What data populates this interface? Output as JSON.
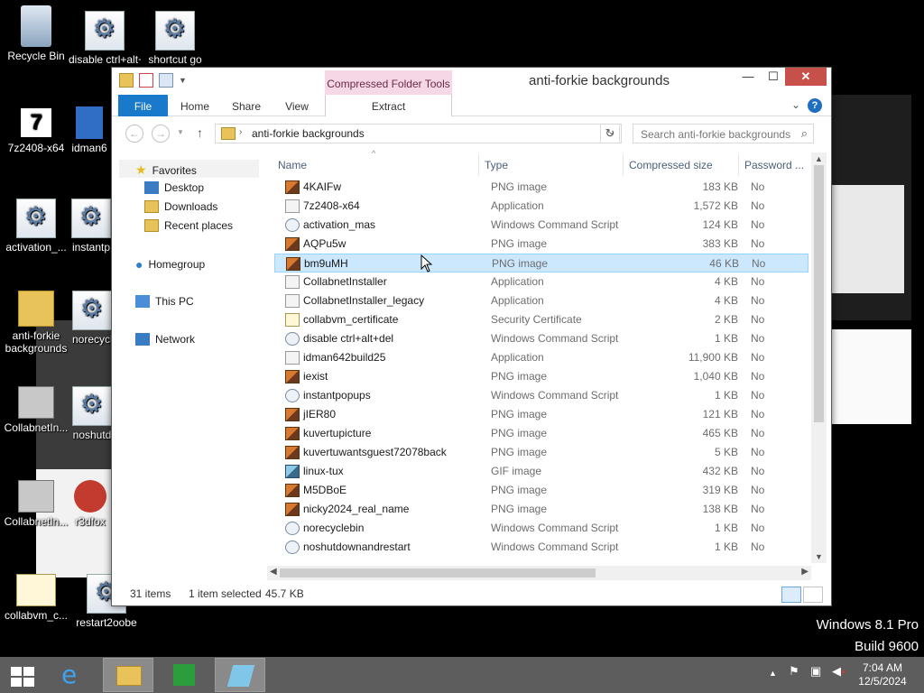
{
  "desktop": {
    "icons": [
      {
        "label": "Recycle Bin"
      },
      {
        "label": "disable ctrl+alt+"
      },
      {
        "label": "shortcut go"
      },
      {
        "label": "7z2408-x64"
      },
      {
        "label": "idman6"
      },
      {
        "label": "activation_..."
      },
      {
        "label": "instantp"
      },
      {
        "label": "anti-forkie backgrounds"
      },
      {
        "label": "norecycl"
      },
      {
        "label": "CollabnetIn..."
      },
      {
        "label": "noshutd"
      },
      {
        "label": "CollabnetIn..."
      },
      {
        "label": "r3dfox"
      },
      {
        "label": "collabvm_c..."
      },
      {
        "label": "restart2oobe"
      }
    ],
    "watermark": {
      "line1": "Windows 8.1 Pro",
      "line2": "Build 9600"
    }
  },
  "window": {
    "title": "anti-forkie backgrounds",
    "context_group": "Compressed Folder Tools",
    "controls": {
      "minimize": "—",
      "maximize": "☐",
      "close": "✕"
    },
    "ribbon_tabs": {
      "file": "File",
      "home": "Home",
      "share": "Share",
      "view": "View",
      "extract": "Extract"
    },
    "address": {
      "path": "anti-forkie backgrounds"
    },
    "search": {
      "placeholder": "Search anti-forkie backgrounds"
    },
    "nav_pane": {
      "favorites": "Favorites",
      "desktop": "Desktop",
      "downloads": "Downloads",
      "recent": "Recent places",
      "homegroup": "Homegroup",
      "thispc": "This PC",
      "network": "Network"
    },
    "columns": {
      "name": "Name",
      "type": "Type",
      "size": "Compressed size",
      "password": "Password ..."
    },
    "files": [
      {
        "name": "4KAIFw",
        "type": "PNG image",
        "size": "183 KB",
        "pw": "No",
        "icon": "png"
      },
      {
        "name": "7z2408-x64",
        "type": "Application",
        "size": "1,572 KB",
        "pw": "No",
        "icon": "app"
      },
      {
        "name": "activation_mas",
        "type": "Windows Command Script",
        "size": "124 KB",
        "pw": "No",
        "icon": "script"
      },
      {
        "name": "AQPu5w",
        "type": "PNG image",
        "size": "383 KB",
        "pw": "No",
        "icon": "png"
      },
      {
        "name": "bm9uMH",
        "type": "PNG image",
        "size": "46 KB",
        "pw": "No",
        "icon": "png",
        "selected": true
      },
      {
        "name": "CollabnetInstaller",
        "type": "Application",
        "size": "4 KB",
        "pw": "No",
        "icon": "app"
      },
      {
        "name": "CollabnetInstaller_legacy",
        "type": "Application",
        "size": "4 KB",
        "pw": "No",
        "icon": "app"
      },
      {
        "name": "collabvm_certificate",
        "type": "Security Certificate",
        "size": "2 KB",
        "pw": "No",
        "icon": "cert"
      },
      {
        "name": "disable ctrl+alt+del",
        "type": "Windows Command Script",
        "size": "1 KB",
        "pw": "No",
        "icon": "script"
      },
      {
        "name": "idman642build25",
        "type": "Application",
        "size": "11,900 KB",
        "pw": "No",
        "icon": "app"
      },
      {
        "name": "iexist",
        "type": "PNG image",
        "size": "1,040 KB",
        "pw": "No",
        "icon": "png"
      },
      {
        "name": "instantpopups",
        "type": "Windows Command Script",
        "size": "1 KB",
        "pw": "No",
        "icon": "script"
      },
      {
        "name": "jIER80",
        "type": "PNG image",
        "size": "121 KB",
        "pw": "No",
        "icon": "png"
      },
      {
        "name": "kuvertupicture",
        "type": "PNG image",
        "size": "465 KB",
        "pw": "No",
        "icon": "png"
      },
      {
        "name": "kuvertuwantsguest72078back",
        "type": "PNG image",
        "size": "5 KB",
        "pw": "No",
        "icon": "png"
      },
      {
        "name": "linux-tux",
        "type": "GIF image",
        "size": "432 KB",
        "pw": "No",
        "icon": "gif"
      },
      {
        "name": "M5DBoE",
        "type": "PNG image",
        "size": "319 KB",
        "pw": "No",
        "icon": "png"
      },
      {
        "name": "nicky2024_real_name",
        "type": "PNG image",
        "size": "138 KB",
        "pw": "No",
        "icon": "png"
      },
      {
        "name": "norecyclebin",
        "type": "Windows Command Script",
        "size": "1 KB",
        "pw": "No",
        "icon": "script"
      },
      {
        "name": "noshutdownandrestart",
        "type": "Windows Command Script",
        "size": "1 KB",
        "pw": "No",
        "icon": "script"
      }
    ],
    "status": {
      "items": "31 items",
      "selected": "1 item selected",
      "size": "45.7 KB"
    }
  },
  "taskbar": {
    "clock_time": "7:04 AM",
    "clock_date": "12/5/2024"
  }
}
